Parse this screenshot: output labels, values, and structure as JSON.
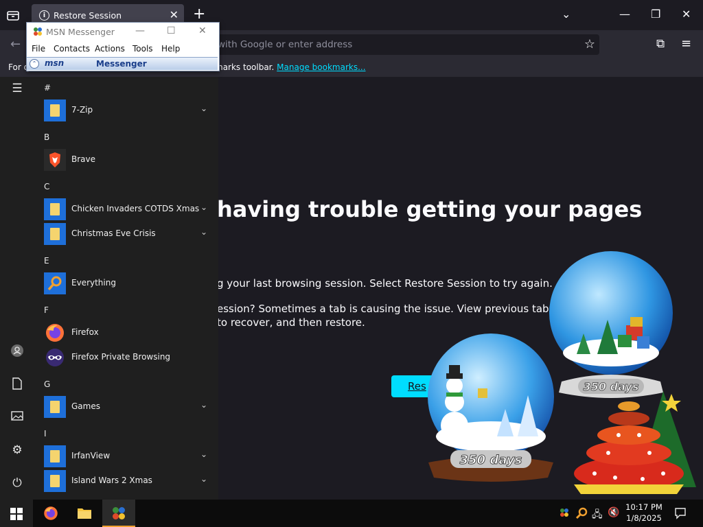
{
  "browser": {
    "tab_title": "Restore Session",
    "url_placeholder": "with Google or enter address",
    "bookmarks_text": "For q",
    "bookmarks_text2": "marks toolbar.",
    "bookmarks_link": "Manage bookmarks..."
  },
  "page": {
    "headline": "having trouble getting your pages",
    "para1": "g your last browsing session. Select Restore Session to try again.",
    "para2_line1": "ession? Sometimes a tab is causing the issue. View previous tabs, remove",
    "para2_line2": "to recover, and then restore.",
    "restore_label": "Res"
  },
  "msn": {
    "title": "MSN Messenger",
    "menu": [
      "File",
      "Contacts",
      "Actions",
      "Tools",
      "Help"
    ],
    "banner_msn": "msn",
    "banner_messenger": "Messenger"
  },
  "start_menu": {
    "groups": [
      {
        "letter": "#",
        "apps": [
          {
            "label": "7-Zip",
            "icon": "folder-icon",
            "expandable": true
          }
        ]
      },
      {
        "letter": "B",
        "apps": [
          {
            "label": "Brave",
            "icon": "brave-icon",
            "expandable": false
          }
        ]
      },
      {
        "letter": "C",
        "apps": [
          {
            "label": "Chicken Invaders COTDS Xmas",
            "icon": "folder-icon",
            "expandable": true
          },
          {
            "label": "Christmas Eve Crisis",
            "icon": "folder-icon",
            "expandable": true
          }
        ]
      },
      {
        "letter": "E",
        "apps": [
          {
            "label": "Everything",
            "icon": "everything-icon",
            "expandable": false
          }
        ]
      },
      {
        "letter": "F",
        "apps": [
          {
            "label": "Firefox",
            "icon": "firefox-icon",
            "expandable": false
          },
          {
            "label": "Firefox Private Browsing",
            "icon": "firefox-private-icon",
            "expandable": false
          }
        ]
      },
      {
        "letter": "G",
        "apps": [
          {
            "label": "Games",
            "icon": "folder-icon",
            "expandable": true
          }
        ]
      },
      {
        "letter": "I",
        "apps": [
          {
            "label": "IrfanView",
            "icon": "folder-icon",
            "expandable": true
          },
          {
            "label": "Island Wars 2 Xmas",
            "icon": "folder-icon",
            "expandable": true
          }
        ]
      }
    ]
  },
  "decorations": {
    "globe_big_text": "350 days",
    "globe_small_text": "350 days"
  },
  "taskbar": {
    "time": "10:17 PM",
    "date": "1/8/2025"
  },
  "colors": {
    "accent_cyan": "#00ddff",
    "page_bg": "#1c1b22",
    "start_bg": "#1f1f1f",
    "taskbar_bg": "#0c0c0c"
  }
}
